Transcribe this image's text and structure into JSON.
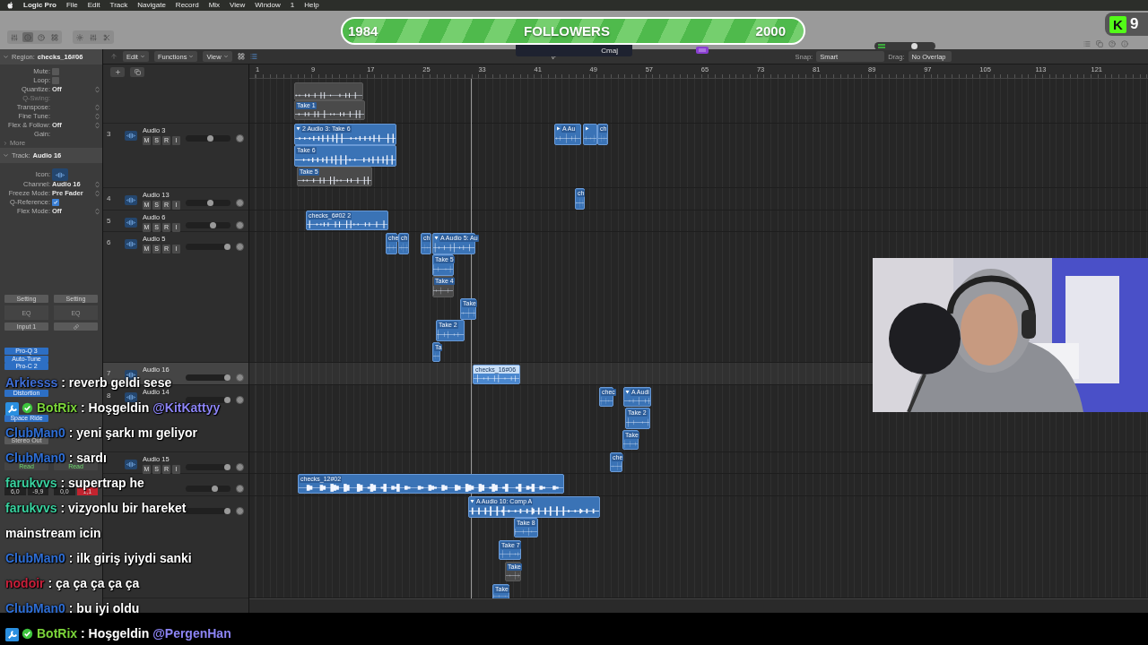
{
  "menu_bar": {
    "app": "Logic Pro",
    "items": [
      "File",
      "Edit",
      "Track",
      "Navigate",
      "Record",
      "Mix",
      "View",
      "Window",
      "1",
      "Help"
    ]
  },
  "control_bar": {
    "view_buttons": [
      {
        "selected": false
      },
      {
        "selected": true
      },
      {
        "selected": false
      },
      {
        "selected": false
      }
    ],
    "key": "Cmaj",
    "master_volume": {
      "level": 0.66
    }
  },
  "followers_goal": {
    "current": "1984",
    "label": "FOLLOWERS",
    "target": "2000"
  },
  "viewer_badge": {
    "logo": "K",
    "count": "9"
  },
  "inspector": {
    "region_title": "Region:",
    "region_name": "checks_16#06",
    "region_fields": [
      {
        "kind": "checkbox",
        "label": "Mute:",
        "checked": false
      },
      {
        "kind": "checkbox",
        "label": "Loop:",
        "checked": false
      },
      {
        "kind": "select",
        "label": "Quantize:",
        "value": "Off"
      },
      {
        "kind": "disabled",
        "label": "Q-Swing:"
      },
      {
        "kind": "select",
        "label": "Transpose:"
      },
      {
        "kind": "select",
        "label": "Fine Tune:"
      },
      {
        "kind": "select",
        "label": "Flex & Follow:",
        "value": "Off"
      },
      {
        "kind": "text",
        "label": "Gain:"
      }
    ],
    "more": "More",
    "track_title": "Track:",
    "track_name": "Audio 16",
    "track_fields": [
      {
        "kind": "icon",
        "label": "Icon:"
      },
      {
        "kind": "select",
        "label": "Channel:",
        "value": "Audio 16"
      },
      {
        "kind": "select",
        "label": "Freeze Mode:",
        "value": "Pre Fader"
      },
      {
        "kind": "checkbox",
        "label": "Q-Reference:",
        "checked": true
      },
      {
        "kind": "select",
        "label": "Flex Mode:",
        "value": "Off"
      }
    ],
    "strips": [
      {
        "setting": "Setting",
        "eq": "EQ",
        "input": "Input 1",
        "plugins": [
          "Pro-Q 3",
          "Auto-Tune",
          "Pro-C 2",
          "Distortion",
          "Space Ride"
        ],
        "output": "Stereo Out",
        "automation": "Read",
        "readouts": [
          "6,0",
          "-9,9"
        ]
      },
      {
        "setting": "Setting",
        "eq": "EQ",
        "automation": "Read",
        "readouts": [
          "0,0",
          "1,1"
        ]
      }
    ]
  },
  "arrange_toolbar": {
    "menus": [
      "Edit",
      "Functions",
      "View"
    ],
    "snap_label": "Snap:",
    "snap": "Smart",
    "drag_label": "Drag:",
    "drag": "No Overlap"
  },
  "ruler": [
    "1",
    "9",
    "17",
    "25",
    "33",
    "41",
    "49",
    "57",
    "65",
    "73",
    "81",
    "89",
    "97",
    "105",
    "113",
    "121"
  ],
  "tracks": [
    {
      "number": "3",
      "name": "Audio 3",
      "buttons": [
        "M",
        "S",
        "R",
        "I"
      ],
      "record": false,
      "level": 0.55,
      "selected": false
    },
    {
      "number": "4",
      "name": "Audio 13",
      "buttons": [
        "M",
        "S",
        "R",
        "I"
      ],
      "record": false,
      "level": 0.55,
      "selected": false
    },
    {
      "number": "5",
      "name": "Audio 6",
      "buttons": [
        "M",
        "S",
        "R",
        "I"
      ],
      "record": false,
      "level": 0.6,
      "selected": false
    },
    {
      "number": "6",
      "name": "Audio 5",
      "buttons": [
        "M",
        "S",
        "R",
        "I"
      ],
      "record": false,
      "level": 0.92,
      "selected": false
    },
    {
      "number": "7",
      "name": "Audio 16",
      "level": 0.92,
      "selected": true
    },
    {
      "number": "8",
      "name": "Audio 14",
      "level": 0.92,
      "selected": false
    },
    {
      "name": "Audio 15",
      "buttons": [
        "M",
        "S",
        "R",
        "I"
      ],
      "record": false,
      "level": 0.92,
      "selected": false
    },
    {
      "level": 0.64,
      "selected": false
    },
    {
      "level": 0.92,
      "selected": false
    }
  ],
  "regions": [
    {
      "kind": "region",
      "active": false,
      "selected": false
    },
    {
      "kind": "region",
      "label": "Take 1",
      "active": false,
      "selected": false
    },
    {
      "kind": "take-folder",
      "label": "2  Audio 3: Take 6",
      "expanded": true,
      "active": true,
      "selected": false
    },
    {
      "kind": "region",
      "label": "Take 6",
      "active": true,
      "selected": false
    },
    {
      "kind": "region",
      "label": "Take 5",
      "active": false,
      "selected": false
    },
    {
      "kind": "take-folder",
      "label": "A  Au",
      "expanded": false,
      "active": true,
      "selected": false
    },
    {
      "kind": "take-folder",
      "expanded": false,
      "active": true,
      "selected": false
    },
    {
      "kind": "region",
      "label": "ch",
      "active": true,
      "selected": false
    },
    {
      "kind": "region",
      "label": "ch",
      "active": true,
      "selected": false
    },
    {
      "kind": "region",
      "label": "checks_6#02 2",
      "active": true,
      "selected": false
    },
    {
      "kind": "region",
      "label": "che",
      "active": true,
      "selected": false
    },
    {
      "kind": "region",
      "label": "ch",
      "active": true,
      "selected": false
    },
    {
      "kind": "region",
      "label": "ch",
      "active": true,
      "selected": false
    },
    {
      "kind": "take-folder",
      "label": "A  Audio 5: Au",
      "expanded": true,
      "active": true,
      "selected": false
    },
    {
      "kind": "region",
      "label": "Take 5",
      "active": true,
      "selected": false
    },
    {
      "kind": "region",
      "label": "Take 4",
      "active": false,
      "selected": false
    },
    {
      "kind": "region",
      "label": "Take",
      "active": true,
      "selected": false
    },
    {
      "kind": "region",
      "label": "Take 2",
      "active": true,
      "selected": false
    },
    {
      "kind": "region",
      "label": "Ta",
      "active": true,
      "selected": false
    },
    {
      "kind": "region",
      "label": "checks_16#06",
      "active": true,
      "selected": true
    },
    {
      "kind": "region",
      "label": "chec",
      "active": true,
      "selected": false
    },
    {
      "kind": "take-folder",
      "label": "A  Audi",
      "expanded": true,
      "active": true,
      "selected": false
    },
    {
      "kind": "region",
      "label": "Take 2",
      "active": true,
      "selected": false
    },
    {
      "kind": "region",
      "label": "Take",
      "active": true,
      "selected": false
    },
    {
      "kind": "region",
      "label": "che",
      "active": true,
      "selected": false
    },
    {
      "kind": "region",
      "label": "checks_12#02",
      "active": true,
      "selected": false
    },
    {
      "kind": "take-folder",
      "label": "A  Audio 10: Comp A",
      "expanded": true,
      "active": true,
      "selected": false
    },
    {
      "kind": "region",
      "label": "Take 8",
      "active": true,
      "selected": false
    },
    {
      "kind": "region",
      "label": "Take 7",
      "active": true,
      "selected": false
    },
    {
      "kind": "region",
      "label": "Take",
      "active": false,
      "selected": false
    },
    {
      "kind": "region",
      "label": "Take",
      "active": true,
      "selected": false
    }
  ],
  "chat": [
    {
      "user": "Arkiesss",
      "color": "#3f6fd8",
      "bot": false,
      "text": ": reverb geldi sese"
    },
    {
      "user": "BotRix",
      "color": "#7cd63a",
      "bot": true,
      "text": ": Hoşgeldin ",
      "mention": "@KitKattyy"
    },
    {
      "user": "ClubMan0",
      "color": "#2f6fd6",
      "bot": false,
      "text": ": yeni şarkı mı geliyor"
    },
    {
      "user": "ClubMan0",
      "color": "#2f6fd6",
      "bot": false,
      "text": ": sardı"
    },
    {
      "user": "farukvvs",
      "color": "#3ad3a0",
      "bot": false,
      "text": ": supertrap he"
    },
    {
      "user": "farukvvs",
      "color": "#3ad3a0",
      "bot": false,
      "text": ": vizyonlu bir hareket mainstream icin"
    },
    {
      "user": "ClubMan0",
      "color": "#2f6fd6",
      "bot": false,
      "text": ": ilk giriş iyiydi sanki"
    },
    {
      "user": "nodoir",
      "color": "#c8203a",
      "bot": false,
      "text": ": ça ça ça ça ça"
    },
    {
      "user": "ClubMan0",
      "color": "#2f6fd6",
      "bot": false,
      "text": ": bu iyi oldu"
    },
    {
      "user": "BotRix",
      "color": "#7cd63a",
      "bot": true,
      "text": ": Hoşgeldin ",
      "mention": "@PergenHan"
    }
  ]
}
